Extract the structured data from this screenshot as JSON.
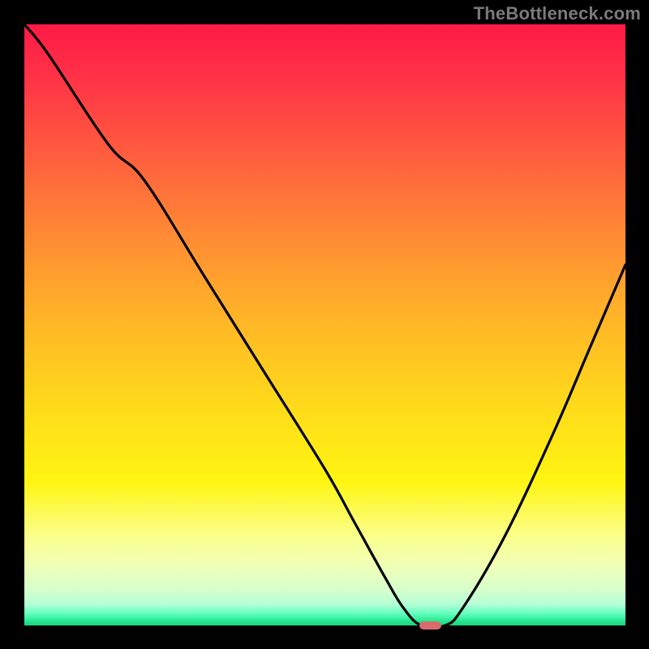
{
  "watermark": "TheBottleneck.com",
  "chart_data": {
    "type": "line",
    "title": "",
    "xlabel": "",
    "ylabel": "",
    "xlim": [
      0,
      100
    ],
    "ylim": [
      0,
      100
    ],
    "gradient_stops": [
      {
        "pos": 0,
        "color": "#ff1a45"
      },
      {
        "pos": 8,
        "color": "#ff3047"
      },
      {
        "pos": 22,
        "color": "#ff5e3e"
      },
      {
        "pos": 35,
        "color": "#ff8a34"
      },
      {
        "pos": 48,
        "color": "#ffb228"
      },
      {
        "pos": 62,
        "color": "#ffd71c"
      },
      {
        "pos": 76,
        "color": "#fff511"
      },
      {
        "pos": 85,
        "color": "#fbff8a"
      },
      {
        "pos": 90,
        "color": "#f0ffb6"
      },
      {
        "pos": 94,
        "color": "#d7ffcc"
      },
      {
        "pos": 96.5,
        "color": "#b4ffd6"
      },
      {
        "pos": 98,
        "color": "#64ffc0"
      },
      {
        "pos": 99.2,
        "color": "#28e892"
      },
      {
        "pos": 100,
        "color": "#1ad27a"
      }
    ],
    "series": [
      {
        "name": "bottleneck-curve",
        "color": "#000000",
        "x": [
          0,
          4,
          14,
          20,
          30,
          40,
          50,
          55,
          60,
          63,
          66,
          70,
          73,
          80,
          88,
          94,
          100
        ],
        "y": [
          100,
          95,
          80,
          74,
          58,
          42,
          26,
          17,
          8,
          3,
          0,
          0,
          3,
          15,
          32,
          46,
          60
        ]
      }
    ],
    "marker": {
      "name": "optimal-point",
      "x": 67.5,
      "y": 0,
      "width_pct": 3.6,
      "height_pct": 1.4,
      "color": "#d86b6b"
    }
  }
}
